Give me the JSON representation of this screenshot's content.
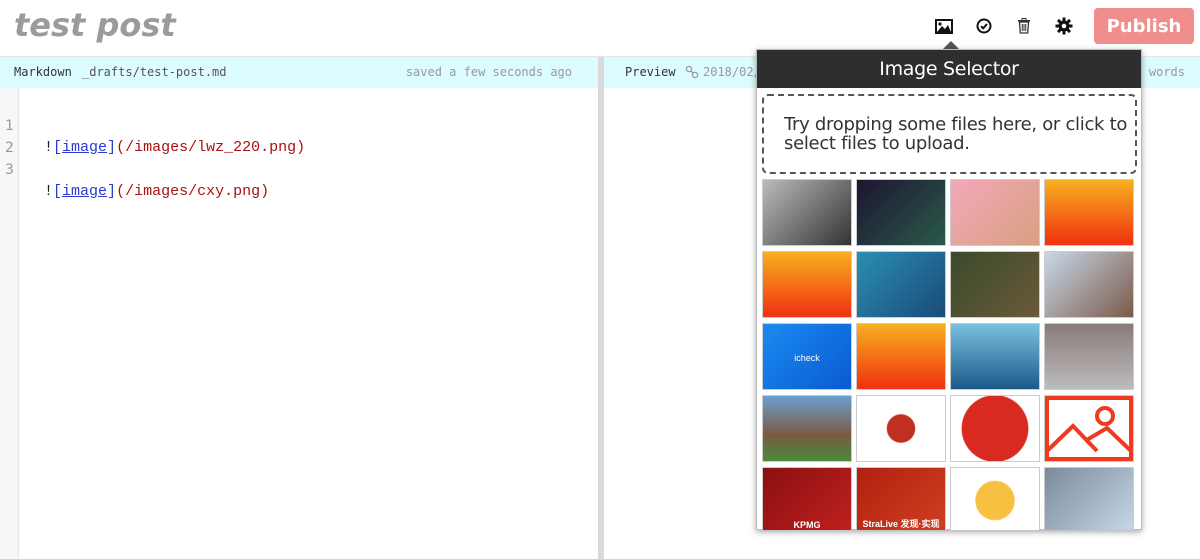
{
  "header": {
    "title": "test post",
    "toolbar": {
      "icons": [
        "image-icon",
        "check-circle-icon",
        "trash-icon",
        "gear-icon"
      ],
      "publish_label": "Publish",
      "publish_color": "#f08d8d"
    }
  },
  "editor": {
    "mode_label": "Markdown",
    "file_path": "_drafts/test-post.md",
    "save_status": "saved a few seconds ago",
    "lines": [
      {
        "number": "1",
        "bang": "!",
        "link_open": "[",
        "link_text": "image",
        "link_close": "]",
        "url": "(/images/lwz_220.png)"
      },
      {
        "number": "2",
        "bang": "",
        "link_open": "",
        "link_text": "",
        "link_close": "",
        "url": ""
      },
      {
        "number": "3",
        "bang": "!",
        "link_open": "[",
        "link_text": "image",
        "link_close": "]",
        "url": "(/images/cxy.png)"
      }
    ]
  },
  "preview": {
    "mode_label": "Preview",
    "date_fragment": "2018/02/",
    "words_label": "words"
  },
  "image_selector": {
    "title": "Image Selector",
    "dropzone_text": "Try dropping some files here, or click to select files to upload.",
    "thumbnails": [
      {
        "name": "portrait-bw",
        "bg": "linear-gradient(135deg,#bbb,#333)",
        "label": ""
      },
      {
        "name": "code-screen",
        "bg": "linear-gradient(135deg,#1d1530,#2a5a4a)",
        "label": ""
      },
      {
        "name": "face-pink",
        "bg": "linear-gradient(135deg,#f2a8b8,#d8a080)",
        "label": ""
      },
      {
        "name": "monkey-laptop",
        "bg": "linear-gradient(180deg,#f8b020,#f03010)",
        "label": ""
      },
      {
        "name": "monkey-laptop",
        "bg": "linear-gradient(180deg,#f8b020,#f03010)",
        "label": ""
      },
      {
        "name": "monkey-king",
        "bg": "linear-gradient(135deg,#2a8fb0,#1a4a7a)",
        "label": ""
      },
      {
        "name": "rabbit-grass",
        "bg": "linear-gradient(135deg,#3a4a2a,#6a5a3a)",
        "label": ""
      },
      {
        "name": "shouting-man",
        "bg": "linear-gradient(135deg,#c8d8e8,#7a5a4a)",
        "label": ""
      },
      {
        "name": "icheck-logo",
        "bg": "linear-gradient(135deg,#1a8af0,#0a5ad0)",
        "label": "icheck"
      },
      {
        "name": "monkey-laptop",
        "bg": "linear-gradient(180deg,#f8b020,#f03010)",
        "label": ""
      },
      {
        "name": "sailboat-sea",
        "bg": "linear-gradient(180deg,#7ac0e0,#1a5a8a)",
        "label": ""
      },
      {
        "name": "race-cars",
        "bg": "linear-gradient(180deg,#8a7a7a,#bcbcbc)",
        "label": ""
      },
      {
        "name": "horse-race",
        "bg": "linear-gradient(180deg,#6aa0d0,#7a5a40 60%,#4a8a3a)",
        "label": ""
      },
      {
        "name": "qr-stralive",
        "bg": "radial-gradient(circle,#c03020 25%,#fff 27%)",
        "label": ""
      },
      {
        "name": "paper-cut-sheep",
        "bg": "radial-gradient(circle,#d82a20 60%,#fff 62%)",
        "label": ""
      },
      {
        "name": "image-placeholder",
        "bg": "linear-gradient(135deg,#fff,#fff)",
        "label": ""
      },
      {
        "name": "kpmg-star",
        "bg": "linear-gradient(135deg,#8a1010,#c02020)",
        "label": "KPMG"
      },
      {
        "name": "stralive-banner",
        "bg": "linear-gradient(135deg,#b02010,#d04020)",
        "label": "StraLive 发现·实现"
      },
      {
        "name": "christmas-ornament",
        "bg": "radial-gradient(circle,#f8c040 35%,#fff 37%)",
        "label": ""
      },
      {
        "name": "fantasy-art",
        "bg": "linear-gradient(135deg,#7a8a9a,#c8d8e8)",
        "label": ""
      }
    ]
  }
}
